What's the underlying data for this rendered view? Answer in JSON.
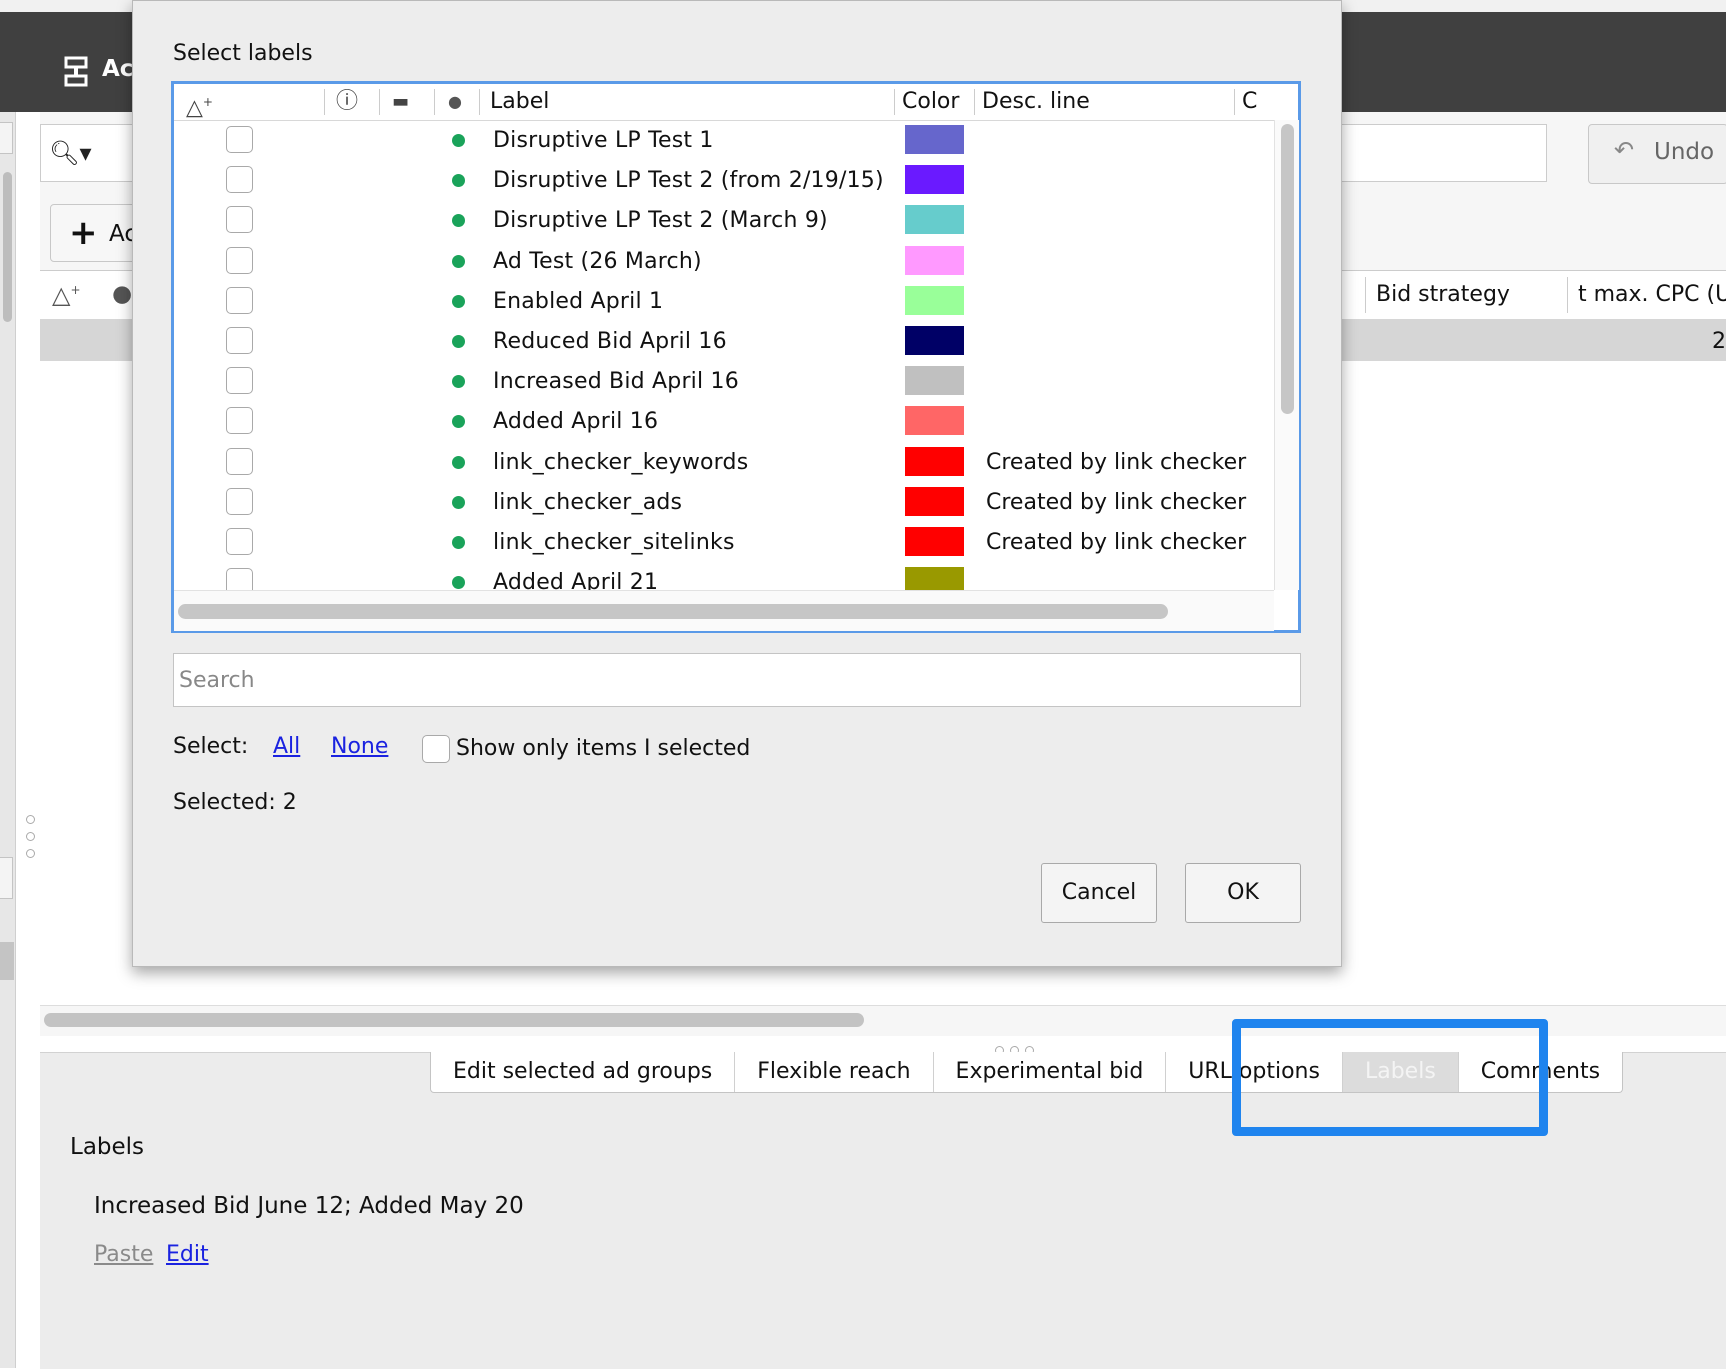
{
  "app": {
    "title_partial": "Ac"
  },
  "toolbar": {
    "undo_label": "Undo",
    "add_label_partial": "Ac"
  },
  "bg_table": {
    "columns": [
      "Bid strategy",
      "t max. CPC (U"
    ],
    "selected_row_value": "2"
  },
  "dialog": {
    "title": "Select labels",
    "columns": {
      "label": "Label",
      "color": "Color",
      "desc": "Desc. line",
      "extra_partial": "C"
    },
    "rows": [
      {
        "label": "Disruptive LP Test 1",
        "color": "#6666cc",
        "desc": ""
      },
      {
        "label": "Disruptive LP Test 2 (from 2/19/15)",
        "color": "#6a1aff",
        "desc": ""
      },
      {
        "label": "Disruptive LP Test 2 (March 9)",
        "color": "#66cccc",
        "desc": ""
      },
      {
        "label": "Ad Test (26 March)",
        "color": "#ff99ff",
        "desc": ""
      },
      {
        "label": "Enabled April 1",
        "color": "#99ff99",
        "desc": ""
      },
      {
        "label": "Reduced Bid April 16",
        "color": "#000066",
        "desc": ""
      },
      {
        "label": "Increased Bid April 16",
        "color": "#c0c0c0",
        "desc": ""
      },
      {
        "label": "Added April 16",
        "color": "#ff6666",
        "desc": ""
      },
      {
        "label": "link_checker_keywords",
        "color": "#ff0000",
        "desc": "Created by link checker"
      },
      {
        "label": "link_checker_ads",
        "color": "#ff0000",
        "desc": "Created by link checker"
      },
      {
        "label": "link_checker_sitelinks",
        "color": "#ff0000",
        "desc": "Created by link checker"
      },
      {
        "label": "Added April 21",
        "color": "#999900",
        "desc": ""
      }
    ],
    "search_placeholder": "Search",
    "select_label": "Select:",
    "all_link": "All",
    "none_link": "None",
    "show_only_label": "Show only items I selected",
    "selected_text": "Selected: 2",
    "cancel_label": "Cancel",
    "ok_label": "OK"
  },
  "bottom_panel": {
    "tabs": [
      {
        "label": "Edit selected ad groups",
        "active": false
      },
      {
        "label": "Flexible reach",
        "active": false
      },
      {
        "label": "Experimental bid",
        "active": false
      },
      {
        "label": "URL options",
        "active": false
      },
      {
        "label": "Labels",
        "active": true
      },
      {
        "label": "Comments",
        "active": false
      }
    ],
    "heading": "Labels",
    "current_labels": "Increased Bid June 12; Added May 20",
    "paste_link": "Paste",
    "edit_link": "Edit"
  },
  "colors": {
    "accent_highlight": "#1f84ee",
    "status_enabled": "#1aa35a",
    "link": "#1a22e0"
  }
}
